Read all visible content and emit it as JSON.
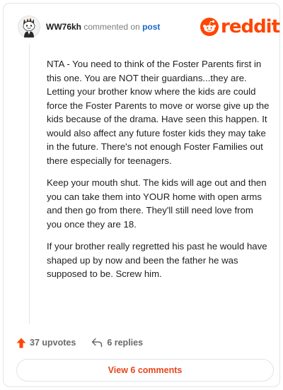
{
  "header": {
    "username": "WW76kh",
    "action": "commented on",
    "post_link": "post",
    "logo_text": "reddit"
  },
  "comment": {
    "paragraphs": [
      "NTA - You need to think of the Foster Parents first in this one. You are NOT their guardians...they are. Letting your brother know where the kids are could force the Foster Parents to move or worse give up the kids because of the drama. Have seen this happen. It would also affect any future foster kids they may take in the future. There's not enough Foster Families out there especially for teenagers.",
      "Keep your mouth shut. The kids will age out and then you can take them into YOUR home with open arms and then go from there. They'll still need love from you once they are 18.",
      "If your brother really regretted his past he would have shaped up by now and been the father he was supposed to be. Screw him."
    ]
  },
  "footer": {
    "upvotes": "37 upvotes",
    "replies": "6 replies",
    "view_comments": "View 6 comments"
  },
  "colors": {
    "reddit_orange": "#ff4500",
    "link_blue": "#1a66c9",
    "button_text": "#e8451b"
  },
  "icons": {
    "upvote": "upvote-arrow-icon",
    "reply": "reply-arrow-icon",
    "logo": "reddit-snoo-icon",
    "avatar": "snoo-avatar-icon"
  }
}
